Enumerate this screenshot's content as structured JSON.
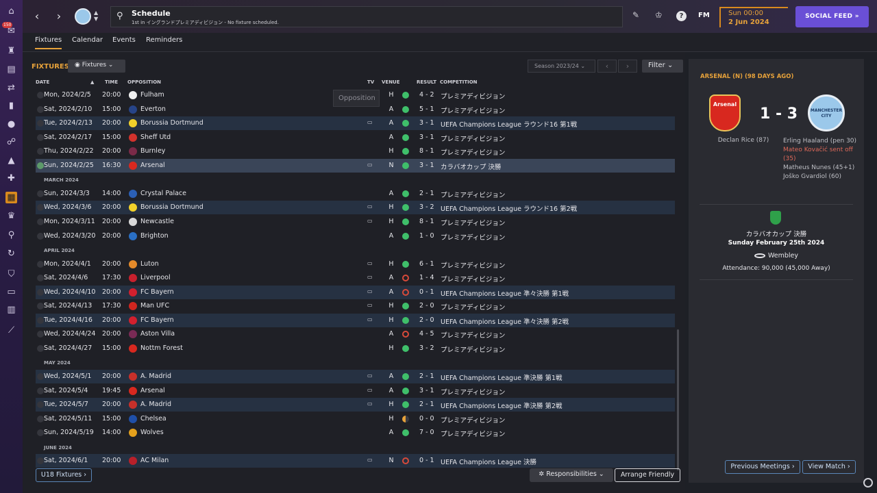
{
  "app": {
    "rail_badge": "150",
    "title": "Schedule",
    "subtitle": "1st in イングランドプレミアディビジョン - No fixture scheduled.",
    "fm_logo": "FM",
    "time": "Sun 00:00",
    "date": "2 Jun 2024",
    "social_feed": "SOCIAL FEED"
  },
  "tabs": [
    "Fixtures",
    "Calendar",
    "Events",
    "Reminders"
  ],
  "fixtures": {
    "header": "FIXTURES",
    "view_dropdown": "Fixtures",
    "season": "Season 2023/24",
    "filter": "Filter",
    "columns": {
      "date": "DATE",
      "time": "TIME",
      "opposition": "OPPOSITION",
      "tv": "TV",
      "venue": "VENUE",
      "result": "RESULT",
      "competition": "COMPETITION"
    },
    "tooltip": "Opposition",
    "rows": [
      {
        "date": "Mon, 2024/2/5",
        "time": "20:00",
        "opp": "Fulham",
        "crest": "#f0f0f0",
        "tv": "",
        "venue": "H",
        "res": "W",
        "score": "4 - 2",
        "comp": "プレミアディビジョン"
      },
      {
        "date": "Sat, 2024/2/10",
        "time": "15:00",
        "opp": "Everton",
        "crest": "#274488",
        "tv": "",
        "venue": "A",
        "res": "W",
        "score": "5 - 1",
        "comp": "プレミアディビジョン"
      },
      {
        "date": "Tue, 2024/2/13",
        "time": "20:00",
        "opp": "Borussia Dortmund",
        "crest": "#f2d12a",
        "tv": "tv",
        "venue": "A",
        "res": "W",
        "score": "3 - 1",
        "comp": "UEFA Champions League ラウンド16 第1戦"
      },
      {
        "date": "Sat, 2024/2/17",
        "time": "15:00",
        "opp": "Sheff Utd",
        "crest": "#d1322c",
        "tv": "",
        "venue": "A",
        "res": "W",
        "score": "3 - 1",
        "comp": "プレミアディビジョン"
      },
      {
        "date": "Thu, 2024/2/22",
        "time": "20:00",
        "opp": "Burnley",
        "crest": "#7a2a48",
        "tv": "",
        "venue": "H",
        "res": "W",
        "score": "8 - 1",
        "comp": "プレミアディビジョン"
      },
      {
        "date": "Sun, 2024/2/25",
        "time": "16:30",
        "opp": "Arsenal",
        "crest": "#d8281f",
        "tv": "tv",
        "venue": "N",
        "res": "W",
        "score": "3 - 1",
        "comp": "カラバオカップ 決勝"
      },
      {
        "month": "MARCH 2024"
      },
      {
        "date": "Sun, 2024/3/3",
        "time": "14:00",
        "opp": "Crystal Palace",
        "crest": "#2b5fb5",
        "tv": "",
        "venue": "A",
        "res": "W",
        "score": "2 - 1",
        "comp": "プレミアディビジョン"
      },
      {
        "date": "Wed, 2024/3/6",
        "time": "20:00",
        "opp": "Borussia Dortmund",
        "crest": "#f2d12a",
        "tv": "tv",
        "venue": "H",
        "res": "W",
        "score": "3 - 2",
        "comp": "UEFA Champions League ラウンド16 第2戦"
      },
      {
        "date": "Mon, 2024/3/11",
        "time": "20:00",
        "opp": "Newcastle",
        "crest": "#d8d8d8",
        "tv": "tv",
        "venue": "H",
        "res": "W",
        "score": "8 - 1",
        "comp": "プレミアディビジョン"
      },
      {
        "date": "Wed, 2024/3/20",
        "time": "20:00",
        "opp": "Brighton",
        "crest": "#2a6fc4",
        "tv": "",
        "venue": "A",
        "res": "W",
        "score": "1 - 0",
        "comp": "プレミアディビジョン"
      },
      {
        "month": "APRIL 2024"
      },
      {
        "date": "Mon, 2024/4/1",
        "time": "20:00",
        "opp": "Luton",
        "crest": "#e48a2a",
        "tv": "tv",
        "venue": "H",
        "res": "W",
        "score": "6 - 1",
        "comp": "プレミアディビジョン"
      },
      {
        "date": "Sat, 2024/4/6",
        "time": "17:30",
        "opp": "Liverpool",
        "crest": "#c8202d",
        "tv": "tv",
        "venue": "A",
        "res": "L",
        "score": "1 - 4",
        "comp": "プレミアディビジョン"
      },
      {
        "date": "Wed, 2024/4/10",
        "time": "20:00",
        "opp": "FC Bayern",
        "crest": "#d3202e",
        "tv": "tv",
        "venue": "A",
        "res": "L",
        "score": "0 - 1",
        "comp": "UEFA Champions League 準々決勝 第1戦"
      },
      {
        "date": "Sat, 2024/4/13",
        "time": "17:30",
        "opp": "Man UFC",
        "crest": "#d0261f",
        "tv": "tv",
        "venue": "H",
        "res": "W",
        "score": "2 - 0",
        "comp": "プレミアディビジョン"
      },
      {
        "date": "Tue, 2024/4/16",
        "time": "20:00",
        "opp": "FC Bayern",
        "crest": "#d3202e",
        "tv": "tv",
        "venue": "H",
        "res": "W",
        "score": "2 - 0",
        "comp": "UEFA Champions League 準々決勝 第2戦"
      },
      {
        "date": "Wed, 2024/4/24",
        "time": "20:00",
        "opp": "Aston Villa",
        "crest": "#7a2a55",
        "tv": "",
        "venue": "A",
        "res": "L",
        "score": "4 - 5",
        "comp": "プレミアディビジョン"
      },
      {
        "date": "Sat, 2024/4/27",
        "time": "15:00",
        "opp": "Nottm Forest",
        "crest": "#d8281f",
        "tv": "",
        "venue": "H",
        "res": "W",
        "score": "3 - 2",
        "comp": "プレミアディビジョン"
      },
      {
        "month": "MAY 2024"
      },
      {
        "date": "Wed, 2024/5/1",
        "time": "20:00",
        "opp": "A. Madrid",
        "crest": "#c8302a",
        "tv": "tv",
        "venue": "A",
        "res": "W",
        "score": "2 - 1",
        "comp": "UEFA Champions League 準決勝 第1戦"
      },
      {
        "date": "Sat, 2024/5/4",
        "time": "19:45",
        "opp": "Arsenal",
        "crest": "#d8281f",
        "tv": "tv",
        "venue": "A",
        "res": "W",
        "score": "3 - 1",
        "comp": "プレミアディビジョン"
      },
      {
        "date": "Tue, 2024/5/7",
        "time": "20:00",
        "opp": "A. Madrid",
        "crest": "#c8302a",
        "tv": "tv",
        "venue": "H",
        "res": "W",
        "score": "2 - 1",
        "comp": "UEFA Champions League 準決勝 第2戦"
      },
      {
        "date": "Sat, 2024/5/11",
        "time": "15:00",
        "opp": "Chelsea",
        "crest": "#1f4fa8",
        "tv": "",
        "venue": "H",
        "res": "D",
        "score": "0 - 0",
        "comp": "プレミアディビジョン"
      },
      {
        "date": "Sun, 2024/5/19",
        "time": "14:00",
        "opp": "Wolves",
        "crest": "#e4a01c",
        "tv": "",
        "venue": "A",
        "res": "W",
        "score": "7 - 0",
        "comp": "プレミアディビジョン"
      },
      {
        "month": "JUNE 2024"
      },
      {
        "date": "Sat, 2024/6/1",
        "time": "20:00",
        "opp": "AC Milan",
        "crest": "#b8202a",
        "tv": "tv",
        "venue": "N",
        "res": "L",
        "score": "0 - 1",
        "comp": "UEFA Champions League 決勝"
      }
    ],
    "u18": "U18 Fixtures",
    "responsibilities": "Responsibilities",
    "arrange": "Arrange Friendly"
  },
  "side": {
    "title": "ARSENAL (N) (98 DAYS AGO)",
    "home_crest": "Arsenal",
    "away_crest_1": "MANCHESTER",
    "away_crest_2": "CITY",
    "score": "1 - 3",
    "home_scorer": "Declan Rice (87)",
    "away_1": "Erling Haaland (pen 30)",
    "away_2": "Mateo Kovačić sent off (35)",
    "away_3": "Matheus Nunes (45+1)",
    "away_4": "Joško Gvardiol (60)",
    "cup": "カラバオカップ 決勝",
    "match_date": "Sunday February 25th 2024",
    "stadium": "Wembley",
    "attendance": "Attendance: 90,000 (45,000 Away)",
    "prev": "Previous Meetings",
    "view": "View Match"
  }
}
